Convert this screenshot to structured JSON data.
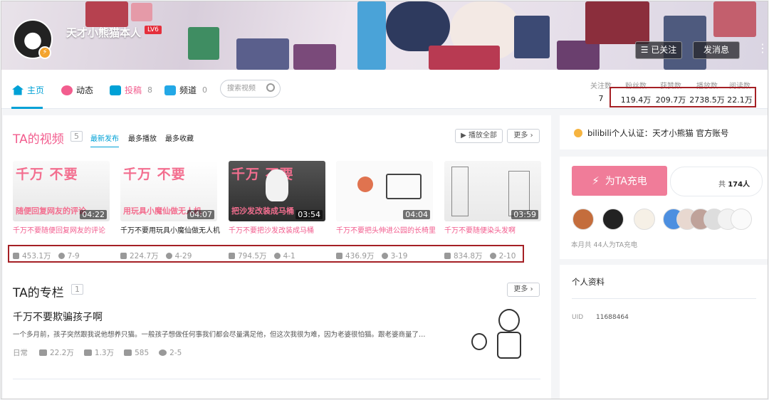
{
  "header": {
    "username": "天才小熊猫本人",
    "level": "LV6",
    "follow_btn": "已关注",
    "message_btn": "发消息",
    "more_icon": "kebab-vertical-icon",
    "colors": {
      "accent_pink": "#f25d8e",
      "accent_blue": "#00a1d6",
      "level_red": "#e52f3c"
    }
  },
  "nav": {
    "tabs": [
      {
        "label": "主页",
        "count": "",
        "icon": "home-icon"
      },
      {
        "label": "动态",
        "count": "",
        "icon": "activity-icon"
      },
      {
        "label": "投稿",
        "count": "8",
        "icon": "upload-icon"
      },
      {
        "label": "频道",
        "count": "0",
        "icon": "channel-icon"
      }
    ],
    "search_placeholder": "搜索视频",
    "stats": [
      {
        "label": "关注数",
        "value": "7"
      },
      {
        "label": "粉丝数",
        "value": "119.4万"
      },
      {
        "label": "获赞数",
        "value": "209.7万"
      },
      {
        "label": "播放数",
        "value": "2738.5万"
      },
      {
        "label": "阅读数",
        "value": "22.1万"
      }
    ]
  },
  "videos_section": {
    "title": "TA的视频",
    "count": "5",
    "sort_tabs": [
      "最新发布",
      "最多播放",
      "最多收藏"
    ],
    "play_all": "播放全部",
    "more": "更多",
    "videos": [
      {
        "thumb_top": "千万  不要",
        "thumb_bottom": "随便回复网友的评论",
        "duration": "04:22",
        "title": "千万不要随便回复网友的评论",
        "plays": "453.1万",
        "date": "7-9"
      },
      {
        "thumb_top": "千万  不要",
        "thumb_bottom": "用玩具小魔仙做无人机",
        "duration": "04:07",
        "title": "千万不要用玩具小魔仙做无人机",
        "plays": "224.7万",
        "date": "4-29"
      },
      {
        "thumb_top": "千万  不要",
        "thumb_bottom": "把沙发改装成马桶",
        "duration": "03:54",
        "title": "千万不要把沙发改装成马桶",
        "plays": "794.5万",
        "date": "4-1"
      },
      {
        "thumb_top": "",
        "thumb_bottom": "",
        "duration": "04:04",
        "title": "千万不要把头伸进公园的长椅里",
        "plays": "436.9万",
        "date": "3-19"
      },
      {
        "thumb_top": "",
        "thumb_bottom": "",
        "duration": "03:59",
        "title": "千万不要随便染头发啊",
        "plays": "834.8万",
        "date": "2-10"
      }
    ]
  },
  "column_section": {
    "title": "TA的专栏",
    "count": "1",
    "more": "更多",
    "article": {
      "title": "千万不要欺骗孩子啊",
      "desc": "一个多月前，孩子突然跟我说他想养只猫。一般孩子想做任何事我们都会尽量满足他，但这次我很为难，因为老婆很怕猫。跟老婆商量了…",
      "category": "日常",
      "views": "22.2万",
      "likes": "1.3万",
      "comments": "585",
      "date": "2-5"
    }
  },
  "sidebar": {
    "verify_text": "bilibili个人认证：天才小熊猫 官方账号",
    "charge_btn": "为TA充电",
    "charge_total_prefix": "共",
    "charge_total": "174人",
    "charge_foot": "本月共 44人为TA充电",
    "profile_title": "个人资料",
    "uid_label": "UID",
    "uid_value": "11688464"
  }
}
